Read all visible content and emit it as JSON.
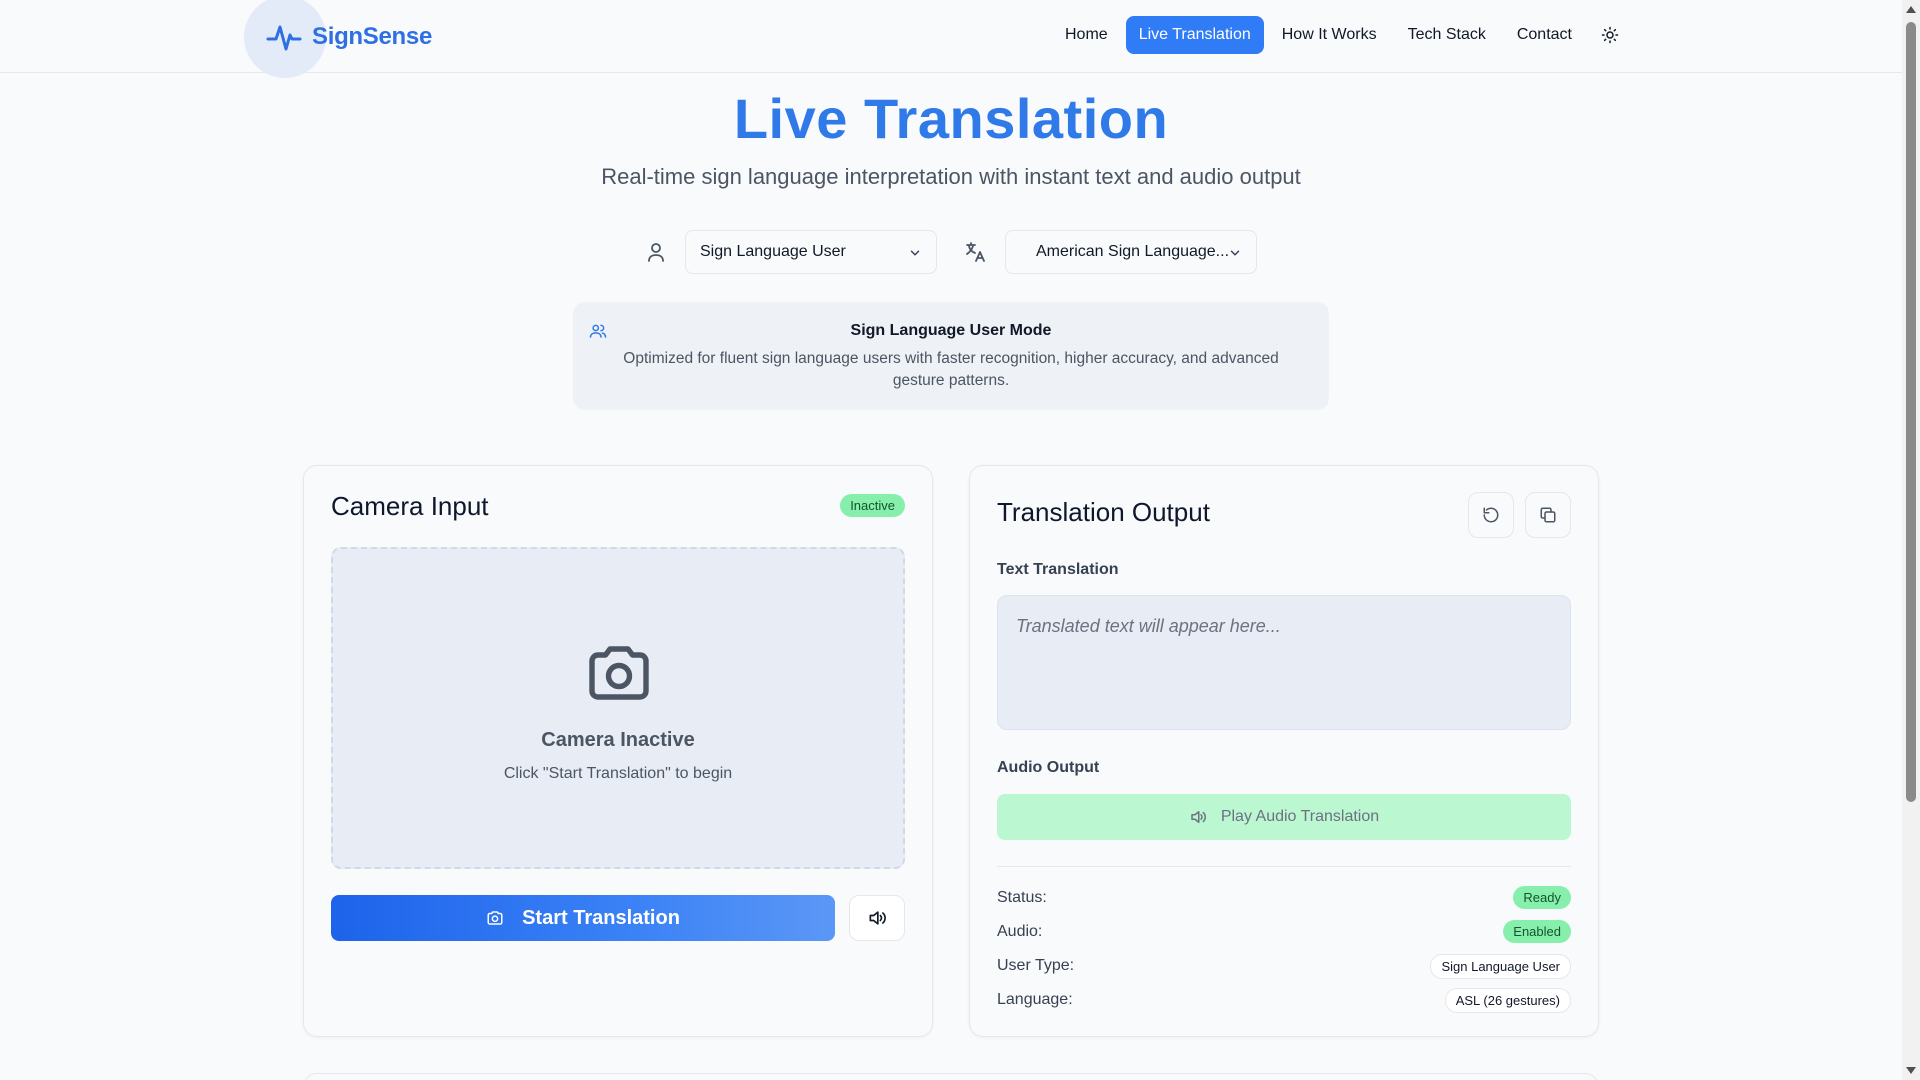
{
  "brand": {
    "name": "SignSense",
    "accent": "#2f7ae8"
  },
  "nav": {
    "items": [
      {
        "label": "Home",
        "active": false
      },
      {
        "label": "Live Translation",
        "active": true
      },
      {
        "label": "How It Works",
        "active": false
      },
      {
        "label": "Tech Stack",
        "active": false
      },
      {
        "label": "Contact",
        "active": false
      }
    ],
    "theme_toggle_icon": "sun-icon"
  },
  "hero": {
    "title": "Live Translation",
    "subtitle": "Real-time sign language interpretation with instant text and audio output"
  },
  "selectors": {
    "user_type": "Sign Language User",
    "language": "American Sign Language..."
  },
  "mode": {
    "title": "Sign Language User Mode",
    "description": "Optimized for fluent sign language users with faster recognition, higher accuracy, and advanced gesture patterns."
  },
  "camera_card": {
    "title": "Camera Input",
    "status_badge": "Inactive",
    "placeholder_title": "Camera Inactive",
    "placeholder_hint": "Click \"Start Translation\" to begin",
    "start_button": "Start Translation"
  },
  "output_card": {
    "title": "Translation Output",
    "text_label": "Text Translation",
    "text_placeholder": "Translated text will appear here...",
    "audio_label": "Audio Output",
    "play_button": "Play Audio Translation",
    "info": [
      {
        "label": "Status:",
        "value": "Ready",
        "style": "green"
      },
      {
        "label": "Audio:",
        "value": "Enabled",
        "style": "green"
      },
      {
        "label": "User Type:",
        "value": "Sign Language User",
        "style": "outline"
      },
      {
        "label": "Language:",
        "value": "ASL (26 gestures)",
        "style": "outline"
      }
    ]
  }
}
